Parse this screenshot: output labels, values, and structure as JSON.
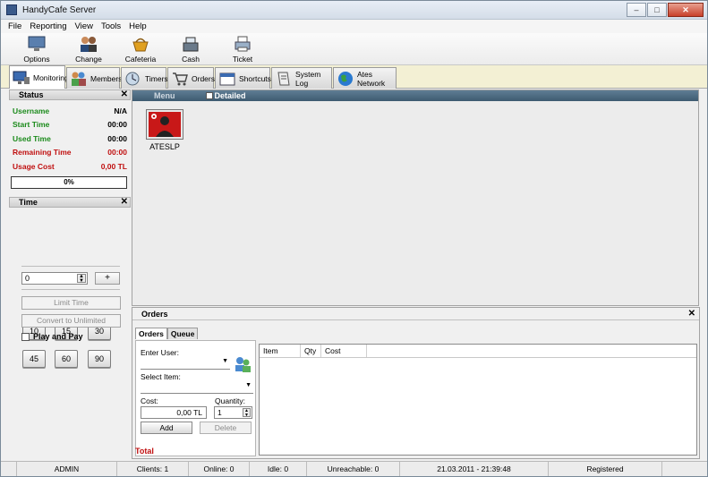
{
  "window": {
    "title": "HandyCafe Server"
  },
  "menu": [
    "File",
    "Reporting",
    "View",
    "Tools",
    "Help"
  ],
  "toolbar": [
    {
      "label": "Options",
      "icon": "monitor-icon"
    },
    {
      "label": "Change Operator",
      "icon": "users-icon"
    },
    {
      "label": "Cafeteria",
      "icon": "basket-icon"
    },
    {
      "label": "Cash",
      "icon": "cash-register-icon"
    },
    {
      "label": "Ticket",
      "icon": "printer-icon"
    }
  ],
  "tabs": [
    {
      "label": "Monitoring",
      "icon": "monitor-icon",
      "active": true
    },
    {
      "label": "Members",
      "icon": "members-icon"
    },
    {
      "label": "Timers",
      "icon": "timer-icon"
    },
    {
      "label": "Orders",
      "icon": "cart-icon"
    },
    {
      "label": "Shortcuts",
      "icon": "calendar-icon"
    },
    {
      "label": "System Log",
      "icon": "log-icon"
    },
    {
      "label": "Ates Network",
      "icon": "globe-icon"
    }
  ],
  "status": {
    "header": "Status",
    "rows": [
      {
        "label": "Username",
        "value": "N/A",
        "color": "#1a8a1a"
      },
      {
        "label": "Start Time",
        "value": "00:00",
        "color": "#1a8a1a"
      },
      {
        "label": "Used Time",
        "value": "00:00",
        "color": "#1a8a1a"
      },
      {
        "label": "Remaining Time",
        "value": "00:00",
        "color": "#c01010"
      },
      {
        "label": "Usage Cost",
        "value": "0,00 TL",
        "color": "#c01010"
      }
    ],
    "progress": "0%"
  },
  "time": {
    "header": "Time",
    "buttons": [
      "10",
      "15",
      "30",
      "45",
      "60",
      "90"
    ],
    "spin_value": "0",
    "plus": "+",
    "limit_time": "Limit Time",
    "convert": "Convert to Unlimited",
    "play_and_pay": "Play and Pay"
  },
  "monitor": {
    "menu_label": "Menu",
    "detailed_label": "Detailed",
    "computers": [
      {
        "name": "ATESLP"
      }
    ]
  },
  "orders": {
    "header": "Orders",
    "tabs": [
      "Orders",
      "Queue"
    ],
    "enter_user": "Enter User:",
    "select_item": "Select Item:",
    "cost_label": "Cost:",
    "cost_value": "0,00 TL",
    "quantity_label": "Quantity:",
    "quantity_value": "1",
    "add": "Add",
    "delete": "Delete",
    "total": "Total",
    "columns": [
      "Item",
      "Qty",
      "Cost"
    ]
  },
  "statusbar": [
    "ADMIN",
    "Clients: 1",
    "Online: 0",
    "Idle: 0",
    "Unreachable: 0",
    "21.03.2011 - 21:39:48",
    "Registered"
  ]
}
